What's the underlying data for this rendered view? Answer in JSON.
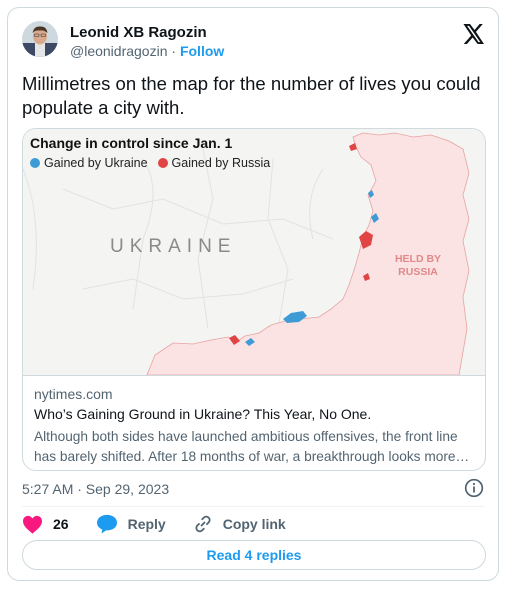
{
  "author": {
    "name": "Leonid XB Ragozin",
    "handle": "@leonidragozin",
    "separator": "·",
    "follow_label": "Follow"
  },
  "tweet_text": "Millimetres on the map for the number of lives you could populate a city with.",
  "link_card": {
    "map": {
      "title": "Change in control since Jan. 1",
      "legend": [
        {
          "label": "Gained by Ukraine",
          "color": "#3e9bd6"
        },
        {
          "label": "Gained by Russia",
          "color": "#e04444"
        }
      ],
      "country_label": "UKRAINE",
      "held_label_line1": "HELD BY",
      "held_label_line2": "RUSSIA",
      "held_color": "#fbe3e3"
    },
    "domain": "nytimes.com",
    "headline": "Who’s Gaining Ground in Ukraine? This Year, No One.",
    "description": "Although both sides have launched ambitious offensives, the front line has barely shifted. After 18 months of war, a breakthrough looks more…"
  },
  "timestamp": "5:27 AM · Sep 29, 2023",
  "actions": {
    "likes": "26",
    "reply_label": "Reply",
    "copy_label": "Copy link"
  },
  "read_replies_label": "Read 4 replies",
  "colors": {
    "accent": "#1d9bf0",
    "like": "#f91880",
    "muted": "#536471"
  }
}
